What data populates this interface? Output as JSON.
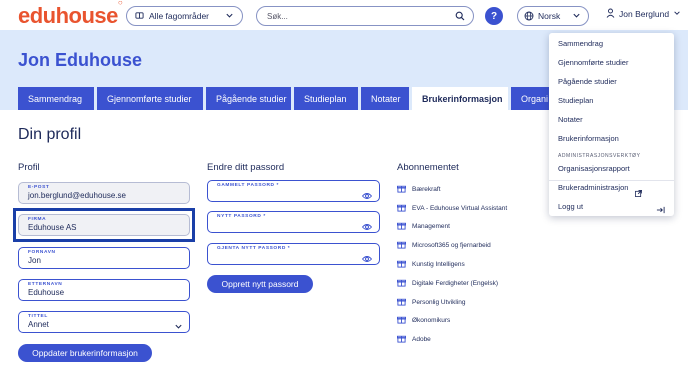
{
  "header": {
    "logo": "eduhouse",
    "area_select": "Alle fagområder",
    "search_placeholder": "Søk...",
    "help": "?",
    "language": "Norsk",
    "user_name": "Jon Berglund"
  },
  "hero": {
    "title": "Jon Eduhouse"
  },
  "tabs": [
    {
      "label": "Sammendrag"
    },
    {
      "label": "Gjennomførte studier"
    },
    {
      "label": "Pågående studier"
    },
    {
      "label": "Studieplan"
    },
    {
      "label": "Notater"
    },
    {
      "label": "Brukerinformasjon"
    },
    {
      "label": "Organi"
    }
  ],
  "page_title": "Din profil",
  "profile": {
    "heading": "Profil",
    "email": {
      "label": "E-POST",
      "value": "jon.berglund@eduhouse.se"
    },
    "company": {
      "label": "FIRMA",
      "value": "Eduhouse AS"
    },
    "first_name": {
      "label": "FORNAVN",
      "value": "Jon"
    },
    "last_name": {
      "label": "ETTERNAVN",
      "value": "Eduhouse"
    },
    "title": {
      "label": "TITTEL",
      "value": "Annet"
    },
    "update_button": "Oppdater brukerinformasjon"
  },
  "password": {
    "heading": "Endre ditt passord",
    "old_label": "GAMMELT PASSORD *",
    "new_label": "NYTT PASSORD *",
    "repeat_label": "GJENTA NYTT PASSORD *",
    "create_button": "Opprett nytt passord"
  },
  "subscriptions": {
    "heading": "Abonnementet",
    "items": [
      "Bærekraft",
      "EVA - Eduhouse Virtual Assistant",
      "Management",
      "Microsoft365 og fjernarbeid",
      "Kunstig Intelligens",
      "Digitale Ferdigheter (Engelsk)",
      "Personlig Utvikling",
      "Økonomikurs",
      "Adobe"
    ]
  },
  "user_menu": {
    "items": [
      "Sammendrag",
      "Gjennomførte studier",
      "Pågående studier",
      "Studieplan",
      "Notater",
      "Brukerinformasjon"
    ],
    "admin_section": "ADMINISTRASJONSVERKTØY",
    "admin_items": [
      "Organisasjonsrapport",
      "Brukeradministrasjon"
    ],
    "logout": "Logg ut"
  },
  "colors": {
    "brand_blue": "#3b52d0",
    "logo_orange": "#e9542f",
    "hero_bg": "#dce9fb",
    "text_dark": "#1e2a5a"
  }
}
